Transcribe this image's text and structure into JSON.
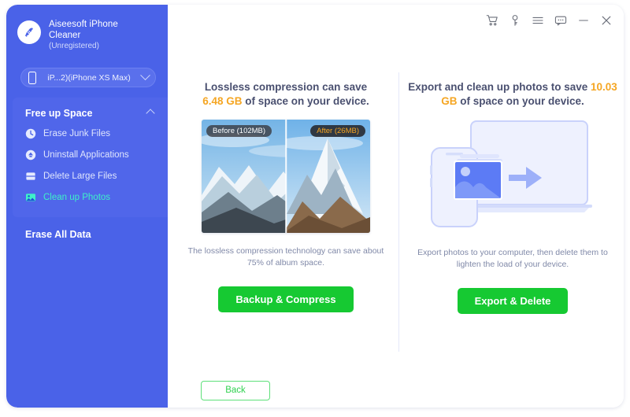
{
  "app": {
    "name_line1": "Aiseesoft iPhone",
    "name_line2": "Cleaner",
    "registration": "(Unregistered)",
    "logo_icon": "broom-circle-icon"
  },
  "device": {
    "icon": "phone-icon",
    "label": "iP...2)(iPhone XS Max)",
    "chevron": "chevron-down-icon"
  },
  "titlebar": {
    "icons": [
      {
        "name": "cart-icon",
        "title": "Buy"
      },
      {
        "name": "key-icon",
        "title": "Register"
      },
      {
        "name": "menu-icon",
        "title": "Menu"
      },
      {
        "name": "chat-icon",
        "title": "Feedback"
      },
      {
        "name": "minimize-icon",
        "title": "Minimize"
      },
      {
        "name": "close-icon",
        "title": "Close"
      }
    ]
  },
  "sidebar": {
    "group_title": "Free up Space",
    "group_chevron": "chevron-up-icon",
    "items": [
      {
        "label": "Erase Junk Files",
        "icon": "clock-icon",
        "active": false
      },
      {
        "label": "Uninstall Applications",
        "icon": "uninstall-icon",
        "active": false
      },
      {
        "label": "Delete Large Files",
        "icon": "file-lines-icon",
        "active": false
      },
      {
        "label": "Clean up Photos",
        "icon": "photo-icon",
        "active": true
      }
    ],
    "erase_all": "Erase All Data"
  },
  "panels": {
    "left": {
      "headline_pre": "Lossless compression can save",
      "headline_amount": "6.48 GB",
      "headline_post": " of space on your device.",
      "badge_before": "Before (102MB)",
      "badge_after": "After (26MB)",
      "caption": "The lossless compression technology can save about 75% of album space.",
      "cta": "Backup & Compress"
    },
    "right": {
      "headline_pre": "Export and clean up photos to save",
      "headline_amount": "10.03 GB",
      "headline_post": " of space on your device.",
      "illustration": "phone-to-laptop-photo-transfer",
      "caption": "Export photos to your computer, then delete them to lighten the load of your device.",
      "cta": "Export & Delete"
    }
  },
  "footer": {
    "back": "Back"
  },
  "colors": {
    "sidebar": "#4a62e8",
    "accent_green": "#16c932",
    "amount_orange": "#f5a623",
    "active_teal": "#3ef0c8"
  }
}
